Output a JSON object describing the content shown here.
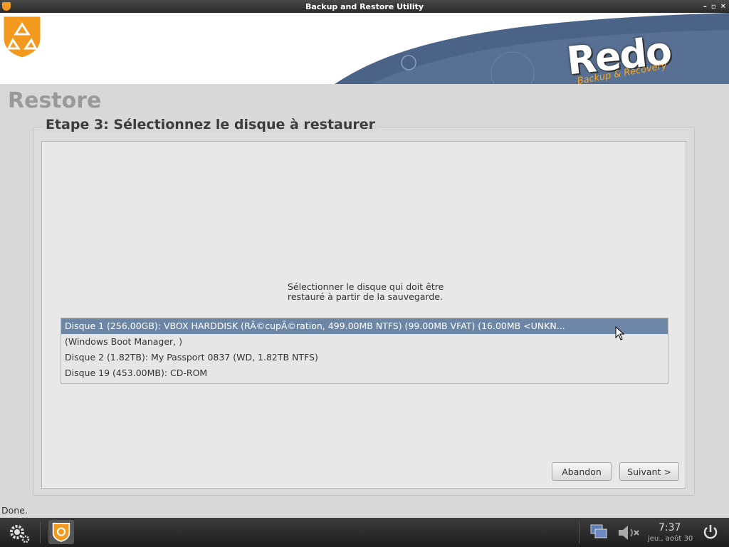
{
  "window": {
    "title": "Backup and Restore Utility"
  },
  "header": {
    "logo": "Redo",
    "logo_sub": "Backup & Recovery"
  },
  "page": {
    "title": "Restore",
    "step_title": "Etape 3: Sélectionnez le disque à restaurer",
    "instruction": "Sélectionner le disque qui doit être\nrestauré à partir de la sauvegarde."
  },
  "disks": [
    {
      "label": "Disque 1 (256.00GB): VBOX HARDDISK (RÃ©cupÃ©ration, 499.00MB NTFS) (99.00MB VFAT) (16.00MB <UNKN...",
      "selected": true
    },
    {
      "label": " (Windows Boot Manager,  )",
      "selected": false
    },
    {
      "label": "Disque 2 (1.82TB): My Passport 0837 (WD, 1.82TB NTFS)",
      "selected": false
    },
    {
      "label": "Disque 19 (453.00MB): CD-ROM",
      "selected": false
    }
  ],
  "buttons": {
    "abandon": "Abandon",
    "next": "Suivant >"
  },
  "status": "Done.",
  "taskbar": {
    "time": "7:37",
    "date": "jeu., août 30"
  },
  "colors": {
    "selection": "#6d86a6",
    "accent": "#f39a1e",
    "banner_wave": "#4a6386"
  }
}
